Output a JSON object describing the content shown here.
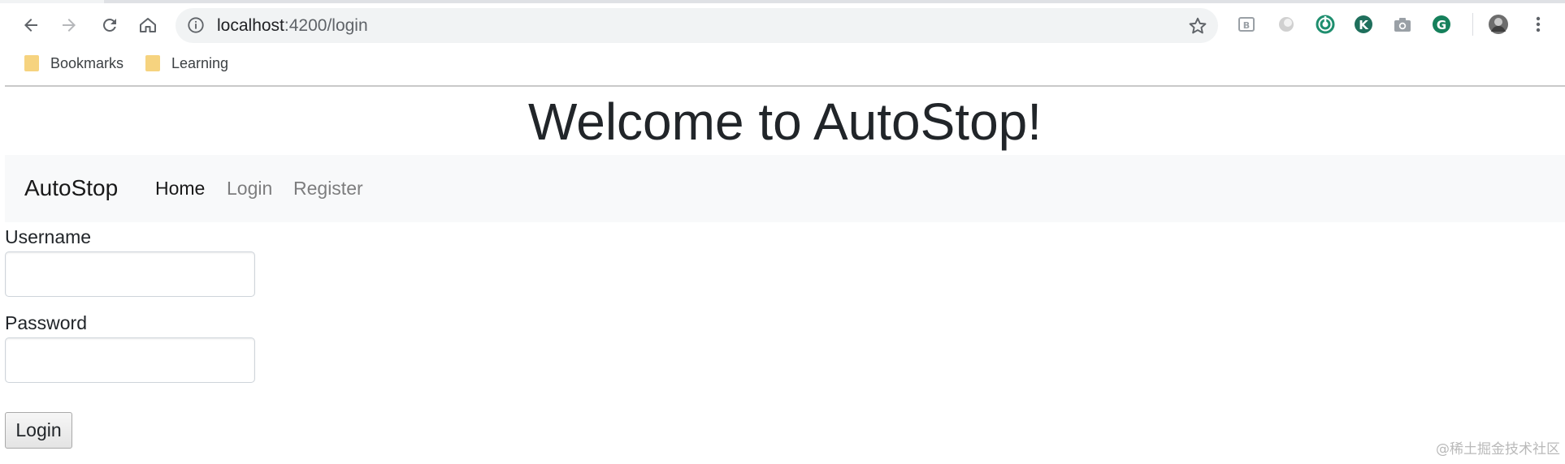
{
  "browser": {
    "url_host": "localhost",
    "url_path": ":4200/login",
    "bookmarks": [
      {
        "label": "Bookmarks",
        "icon": "folder-icon"
      },
      {
        "label": "Learning",
        "icon": "folder-icon"
      }
    ],
    "icons": {
      "back": "arrow-left-icon",
      "forward": "arrow-right-icon",
      "reload": "reload-icon",
      "home": "home-icon",
      "info": "info-icon",
      "star": "star-icon",
      "menu": "kebab-menu-icon"
    },
    "colors": {
      "toolbar": "#ffffff",
      "omnibox": "#f1f3f4",
      "folder": "#f6d37f"
    }
  },
  "page": {
    "heading": "Welcome to AutoStop!",
    "navbar": {
      "brand": "AutoStop",
      "links": [
        {
          "label": "Home",
          "active": true
        },
        {
          "label": "Login",
          "active": false
        },
        {
          "label": "Register",
          "active": false
        }
      ]
    },
    "form": {
      "username_label": "Username",
      "username_value": "",
      "password_label": "Password",
      "password_value": "",
      "submit_label": "Login"
    },
    "colors": {
      "navbar_bg": "#f8f9fa",
      "text": "#212529"
    }
  },
  "watermark": "@稀土掘金技术社区"
}
